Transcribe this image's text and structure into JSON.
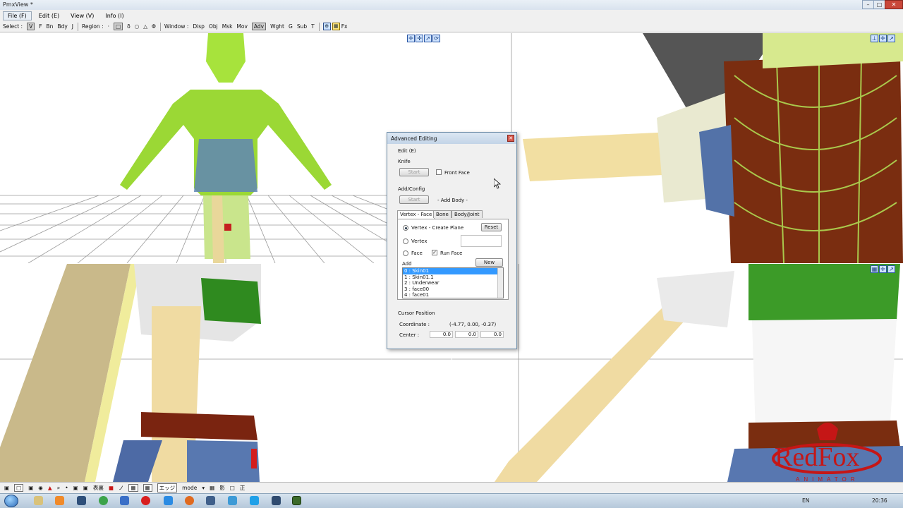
{
  "window": {
    "title": "PmxView *",
    "min": "–",
    "max": "□",
    "close": "✕"
  },
  "menu": [
    "File (F)",
    "Edit (E)",
    "View (V)",
    "Info (I)"
  ],
  "toolbar": {
    "select_label": "Select :",
    "select_items": [
      "V",
      "F",
      "Bn",
      "Bdy",
      "J"
    ],
    "region_label": "Region :",
    "region_items": [
      "·",
      "□",
      "δ",
      "○",
      "△",
      "Φ"
    ],
    "window_label": "Window :",
    "window_items": [
      "Disp",
      "Obj",
      "Msk",
      "Mov",
      "Adv",
      "Wght",
      "G",
      "Sub",
      "T"
    ],
    "fx": "Fx"
  },
  "viewport_tools": {
    "top_left": [
      "✛",
      "✛",
      "↗",
      "⟳"
    ],
    "top_right": [
      "⊥",
      "✛",
      "↗"
    ],
    "bottom_right": [
      "▦",
      "✛",
      "↗"
    ]
  },
  "dialog": {
    "title": "Advanced Editing",
    "close": "✕",
    "edit_menu": "Edit (E)",
    "knife": {
      "label": "Knife",
      "start": "Start",
      "front_face": "Front Face"
    },
    "addconfig": {
      "label": "Add/Config",
      "start": "Start",
      "body_text": "- Add Body -"
    },
    "tabs": [
      "Vertex - Face",
      "Bone",
      "Body/Joint"
    ],
    "options": {
      "vertex_create_plane": "Vertex - Create Plane",
      "reset": "Reset",
      "vertex": "Vertex",
      "face": "Face",
      "run_face": "Run Face",
      "check_mark": "✓",
      "new": "New",
      "add": "Add"
    },
    "list": [
      "0 : Skin01",
      "1 : Skin01.1",
      "2 : Underwear",
      "3 : face00",
      "4 : face01"
    ],
    "cursor": {
      "label": "Cursor Position",
      "coordinate_label": "Coordinate :",
      "coordinate_value": "(-4.77, 0.00, -0.37)",
      "center_label": "Center :",
      "center_values": [
        "0.0",
        "0.0",
        "0.0"
      ]
    }
  },
  "bottombar": [
    "▣",
    "□",
    "▣",
    "◉",
    "▲",
    "»",
    "•",
    "▣",
    "▣",
    "表裏",
    "■",
    "ノ",
    "▦",
    "▦",
    "エッジ",
    "mode",
    "▾",
    "▦",
    "影",
    "□",
    "正"
  ],
  "taskbar": {
    "lang": "EN",
    "clock": "20:36"
  },
  "logo": {
    "text": "RedFox",
    "subtitle": "ANIMATOR"
  }
}
